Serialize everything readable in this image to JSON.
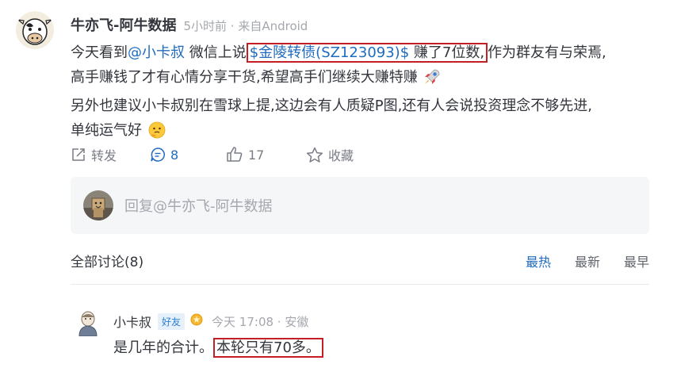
{
  "post": {
    "author": "牛亦飞-阿牛数据",
    "meta": "5小时前 · 来自Android",
    "body": {
      "p1_a": "今天看到",
      "mention": "@小卡叔",
      "p1_b": " 微信上说",
      "stock": "$金陵转债(SZ123093)$",
      "p1_c": " 赚了7位数,",
      "p1_d": "作为群友有与荣焉,",
      "p2": "高手赚钱了才有心情分享干货,希望高手们继续大赚特赚",
      "p3": "另外也建议小卡叔别在雪球上提,这边会有人质疑P图,还有人会说投资理念不够先进,",
      "p4": "单纯运气好"
    }
  },
  "actions": {
    "repost": "转发",
    "comments": "8",
    "likes": "17",
    "favorite": "收藏"
  },
  "reply": {
    "placeholder": "回复@牛亦飞-阿牛数据"
  },
  "discussion": {
    "title": "全部讨论(8)",
    "sort": [
      "最热",
      "最新",
      "最早"
    ]
  },
  "comment": {
    "name": "小卡叔",
    "badge": "好友",
    "meta": "今天 17:08 · 安徽",
    "text_a": "是几年的合计。",
    "text_b": "本轮只有70多。"
  },
  "icons": {
    "repost": "share-icon",
    "comment": "comment-icon",
    "like": "thumb-up-icon",
    "favorite": "star-icon"
  },
  "colors": {
    "link": "#1f6bbf",
    "highlight_box": "#c41f24",
    "muted": "#a4a7ad"
  }
}
